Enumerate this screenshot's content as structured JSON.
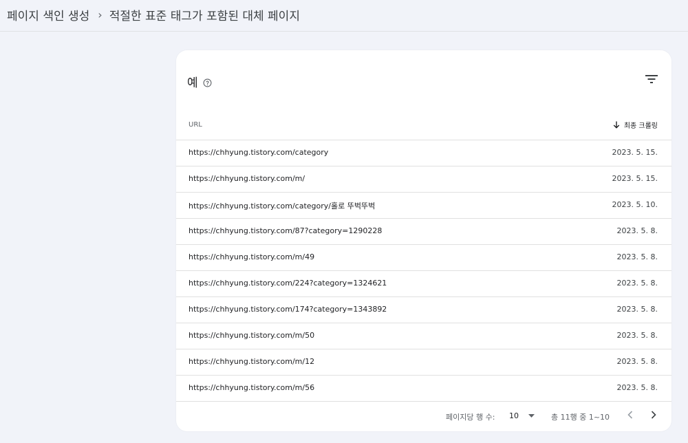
{
  "breadcrumb": {
    "parent": "페이지 색인 생성",
    "separator": "›",
    "current": "적절한 표준 태그가 포함된 대체 페이지"
  },
  "card": {
    "title": "예",
    "help_icon": "help-circle-icon",
    "filter_icon": "filter-icon"
  },
  "table": {
    "columns": {
      "url": "URL",
      "last_crawled": "최종 크롤링"
    },
    "sort": {
      "column": "last_crawled",
      "direction": "descending",
      "icon": "arrow-down-icon"
    },
    "rows": [
      {
        "url": "https://chhyung.tistory.com/category",
        "date": "2023. 5. 15."
      },
      {
        "url": "https://chhyung.tistory.com/m/",
        "date": "2023. 5. 15."
      },
      {
        "url": "https://chhyung.tistory.com/category/홀로 뚜벅뚜벅",
        "date": "2023. 5. 10."
      },
      {
        "url": "https://chhyung.tistory.com/87?category=1290228",
        "date": "2023. 5. 8."
      },
      {
        "url": "https://chhyung.tistory.com/m/49",
        "date": "2023. 5. 8."
      },
      {
        "url": "https://chhyung.tistory.com/224?category=1324621",
        "date": "2023. 5. 8."
      },
      {
        "url": "https://chhyung.tistory.com/174?category=1343892",
        "date": "2023. 5. 8."
      },
      {
        "url": "https://chhyung.tistory.com/m/50",
        "date": "2023. 5. 8."
      },
      {
        "url": "https://chhyung.tistory.com/m/12",
        "date": "2023. 5. 8."
      },
      {
        "url": "https://chhyung.tistory.com/m/56",
        "date": "2023. 5. 8."
      }
    ]
  },
  "pagination": {
    "rows_per_page_label": "페이지당 행 수:",
    "rows_per_page_value": "10",
    "range_label": "총 11행 중 1~10",
    "prev_icon": "chevron-left-icon",
    "next_icon": "chevron-right-icon"
  },
  "colors": {
    "background": "#f1f3f9",
    "card": "#ffffff",
    "divider": "#e0e0e0",
    "text": "#202124",
    "muted_text": "#5f6368"
  }
}
